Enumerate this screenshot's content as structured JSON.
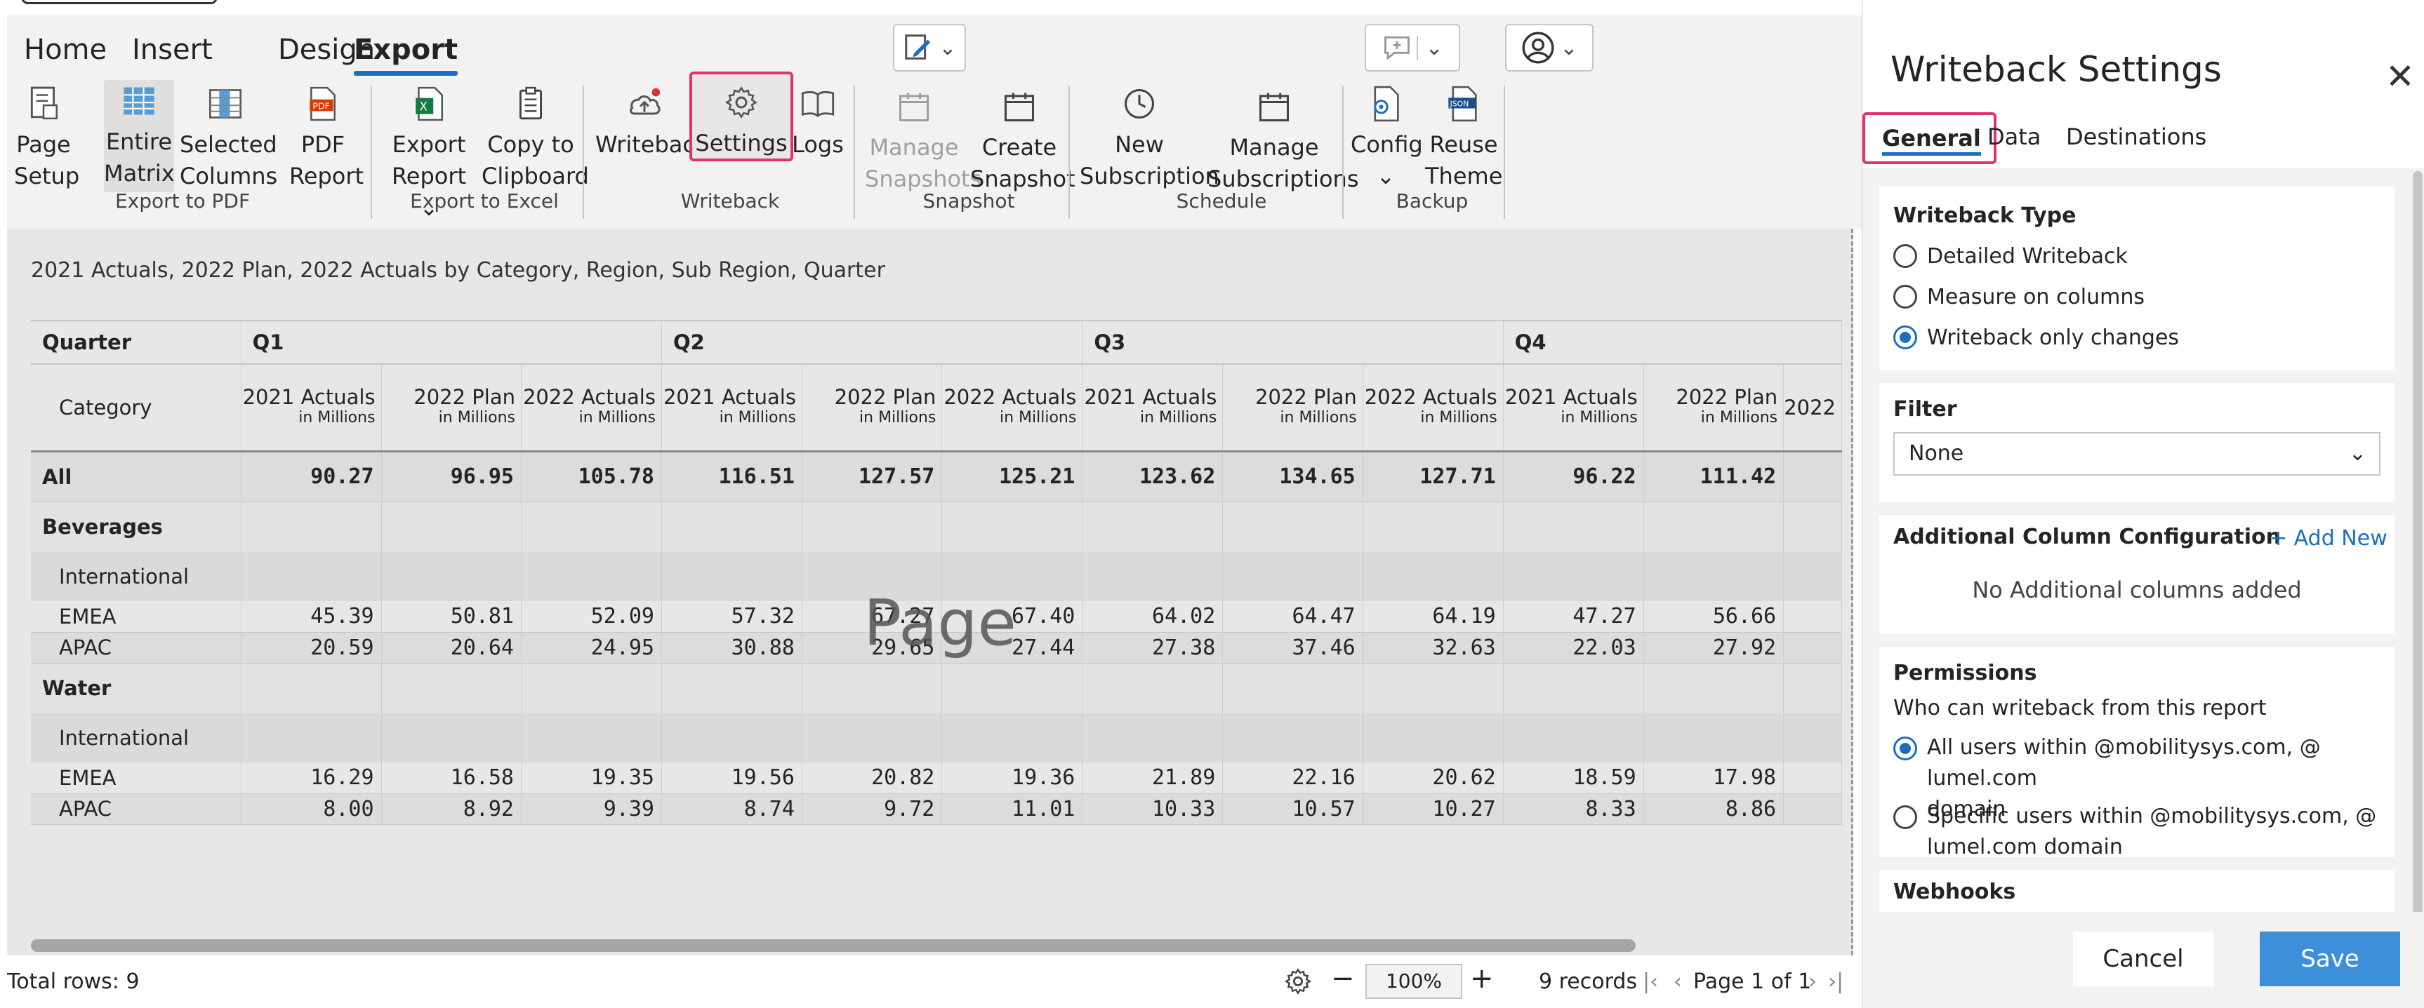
{
  "menu": {
    "tabs": [
      "Home",
      "Insert",
      "Design",
      "Export"
    ],
    "active": "Export"
  },
  "ribbon": {
    "groups": {
      "export_pdf": "Export to PDF",
      "export_excel": "Export to Excel",
      "writeback": "Writeback",
      "snapshot": "Snapshot",
      "schedule": "Schedule",
      "backup": "Backup"
    },
    "items": {
      "page_setup": [
        "Page",
        "Setup"
      ],
      "entire_matrix": [
        "Entire",
        "Matrix"
      ],
      "selected_columns": [
        "Selected",
        "Columns"
      ],
      "pdf_report": [
        "PDF",
        "Report"
      ],
      "export_report": [
        "Export",
        "Report"
      ],
      "copy_clipboard": [
        "Copy to",
        "Clipboard"
      ],
      "writeback": "Writeback",
      "settings": "Settings",
      "logs": "Logs",
      "manage_snapshots": [
        "Manage",
        "Snapshots"
      ],
      "create_snapshot": [
        "Create",
        "Snapshot"
      ],
      "new_subscription": [
        "New",
        "Subscription"
      ],
      "manage_subscriptions": [
        "Manage",
        "Subscriptions"
      ],
      "config": "Config",
      "reuse_theme": [
        "Reuse",
        "Theme"
      ]
    }
  },
  "report": {
    "title": "2021 Actuals, 2022 Plan, 2022 Actuals by Category, Region, Sub Region, Quarter",
    "header_quarter": "Quarter",
    "header_category": "Category",
    "quarters": [
      "Q1",
      "Q2",
      "Q3",
      "Q4"
    ],
    "measures": [
      "2021 Actuals",
      "2022 Plan",
      "2022 Actuals"
    ],
    "unit": "in Millions",
    "truncated_measure": "2022",
    "rows": [
      {
        "type": "all",
        "label": "All",
        "values": [
          "90.27",
          "96.95",
          "105.78",
          "116.51",
          "127.57",
          "125.21",
          "123.62",
          "134.65",
          "127.71",
          "96.22",
          "111.42"
        ]
      },
      {
        "type": "cat",
        "label": "Beverages"
      },
      {
        "type": "sub",
        "label": "International"
      },
      {
        "type": "leaf",
        "label": "EMEA",
        "values": [
          "45.39",
          "50.81",
          "52.09",
          "57.32",
          "67.27",
          "67.40",
          "64.02",
          "64.47",
          "64.19",
          "47.27",
          "56.66"
        ]
      },
      {
        "type": "leaf",
        "label": "APAC",
        "values": [
          "20.59",
          "20.64",
          "24.95",
          "30.88",
          "29.65",
          "27.44",
          "27.38",
          "37.46",
          "32.63",
          "22.03",
          "27.92"
        ]
      },
      {
        "type": "cat",
        "label": "Water"
      },
      {
        "type": "sub",
        "label": "International"
      },
      {
        "type": "leaf",
        "label": "EMEA",
        "values": [
          "16.29",
          "16.58",
          "19.35",
          "19.56",
          "20.82",
          "19.36",
          "21.89",
          "22.16",
          "20.62",
          "18.59",
          "17.98"
        ]
      },
      {
        "type": "leaf",
        "label": "APAC",
        "values": [
          "8.00",
          "8.92",
          "9.39",
          "8.74",
          "9.72",
          "11.01",
          "10.33",
          "10.57",
          "10.27",
          "8.33",
          "8.86"
        ]
      }
    ],
    "watermark": "Page"
  },
  "status": {
    "total_rows": "Total rows: 9",
    "zoom": "100%",
    "records": "9 records",
    "page": "Page 1 of 1"
  },
  "panel": {
    "title": "Writeback Settings",
    "tabs": [
      "General",
      "Data",
      "Destinations"
    ],
    "writeback_type": {
      "title": "Writeback Type",
      "options": [
        "Detailed Writeback",
        "Measure on columns",
        "Writeback only changes"
      ],
      "selected": 2
    },
    "filter": {
      "title": "Filter",
      "value": "None"
    },
    "additional": {
      "title": "Additional Column Configuration",
      "add_new": "+ Add New",
      "empty": "No Additional columns added"
    },
    "permissions": {
      "title": "Permissions",
      "question": "Who can writeback from this report",
      "options": [
        [
          "All users within @mobilitysys.com, @ lumel.com",
          "domain"
        ],
        [
          "Specific users within @mobilitysys.com, @",
          "lumel.com domain"
        ]
      ],
      "selected": 0
    },
    "webhooks": "Webhooks",
    "cancel": "Cancel",
    "save": "Save"
  },
  "colors": {
    "accent": "#1b6ec2",
    "highlight": "#e0336b",
    "save_button": "#3d8fd9"
  }
}
